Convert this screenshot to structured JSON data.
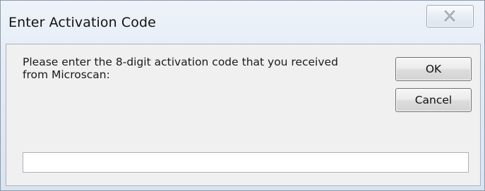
{
  "window": {
    "title": "Enter Activation Code"
  },
  "dialog": {
    "prompt": "Please enter the 8-digit activation code that you received\nfrom Microscan:",
    "ok_label": "OK",
    "cancel_label": "Cancel",
    "code_input": {
      "value": "",
      "placeholder": ""
    }
  },
  "icons": {
    "close": "close-icon"
  }
}
